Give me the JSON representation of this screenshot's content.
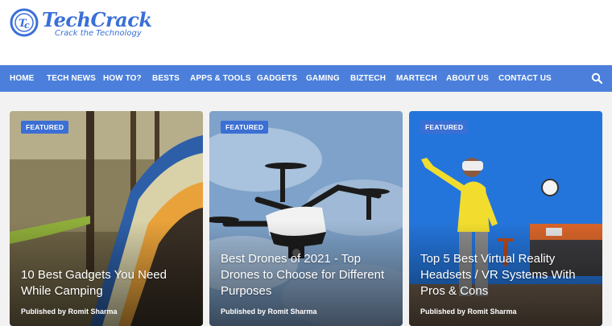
{
  "site": {
    "name": "TechCrack",
    "tagline": "Crack the Technology"
  },
  "nav": {
    "items": [
      "HOME",
      "TECH NEWS",
      "HOW TO?",
      "BESTS",
      "APPS & TOOLS",
      "GADGETS",
      "GAMING",
      "BIZTECH",
      "MARTECH",
      "ABOUT US",
      "CONTACT US"
    ],
    "search_icon": "search-icon"
  },
  "colors": {
    "nav_bg": "#4b7fdb",
    "brand": "#3a6fd8",
    "badge": "#3b6fd4"
  },
  "cards": [
    {
      "badge": "FEATURED",
      "title": "10 Best Gadgets You Need While Camping",
      "byline_prefix": "Published by",
      "author": "Romit Sharma"
    },
    {
      "badge": "FEATURED",
      "title": "Best Drones of 2021 - Top Drones to Choose for Different Purposes",
      "byline_prefix": "Published by",
      "author": "Romit Sharma"
    },
    {
      "badge": "FEATURED",
      "title": "Top 5 Best Virtual Reality Headsets / VR Systems With Pros & Cons",
      "byline_prefix": "Published by",
      "author": "Romit Sharma"
    }
  ]
}
